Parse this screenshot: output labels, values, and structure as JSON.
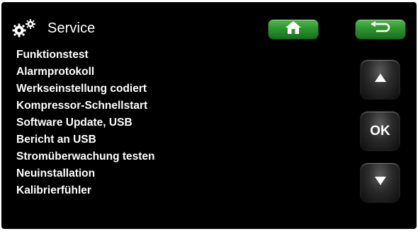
{
  "header": {
    "icon": "gears-icon",
    "title": "Service",
    "home_button_icon": "home-icon",
    "back_button_icon": "back-arrow-icon"
  },
  "menu": {
    "items": [
      "Funktionstest",
      "Alarmprotokoll",
      "Werkseinstellung codiert",
      "Kompressor-Schnellstart",
      "Software Update, USB",
      "Bericht an USB",
      "Stromüberwachung testen",
      "Neuinstallation",
      "Kalibrierfühler"
    ]
  },
  "side_buttons": {
    "up_icon": "triangle-up-icon",
    "ok_label": "OK",
    "down_icon": "triangle-down-icon"
  },
  "colors": {
    "background": "#000000",
    "text": "#ffffff",
    "nav_button": "#2e9530",
    "side_button": "#2a2a2a"
  }
}
